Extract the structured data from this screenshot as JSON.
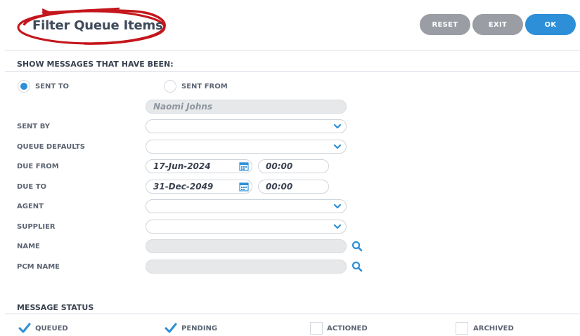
{
  "header": {
    "title": "Filter Queue Items",
    "buttons": {
      "reset": "RESET",
      "exit": "EXIT",
      "ok": "OK"
    }
  },
  "show_messages": {
    "heading": "SHOW MESSAGES THAT HAVE BEEN:",
    "sent_to_label": "SENT TO",
    "sent_from_label": "SENT FROM",
    "selected": "SENT TO",
    "recipient_value": "Naomi Johns"
  },
  "fields": {
    "sent_by": {
      "label": "SENT BY",
      "value": ""
    },
    "queue_defaults": {
      "label": "QUEUE DEFAULTS",
      "value": ""
    },
    "due_from": {
      "label": "DUE FROM",
      "date": "17-Jun-2024",
      "time": "00:00"
    },
    "due_to": {
      "label": "DUE TO",
      "date": "31-Dec-2049",
      "time": "00:00"
    },
    "agent": {
      "label": "AGENT",
      "value": ""
    },
    "supplier": {
      "label": "SUPPLIER",
      "value": ""
    },
    "name": {
      "label": "NAME",
      "value": ""
    },
    "pcm_name": {
      "label": "PCM NAME",
      "value": ""
    }
  },
  "message_status": {
    "heading": "MESSAGE STATUS",
    "options": [
      {
        "label": "QUEUED",
        "checked": true
      },
      {
        "label": "PENDING",
        "checked": true
      },
      {
        "label": "ACTIONED",
        "checked": false
      },
      {
        "label": "ARCHIVED",
        "checked": false
      }
    ]
  },
  "colors": {
    "accent": "#2d8fd8",
    "button_grey": "#9a9ea4",
    "annotation_red": "#c4161c"
  },
  "icons": {
    "dropdown": "chevron-down-icon",
    "calendar": "calendar-icon",
    "search": "search-icon",
    "check": "checkmark-icon"
  }
}
